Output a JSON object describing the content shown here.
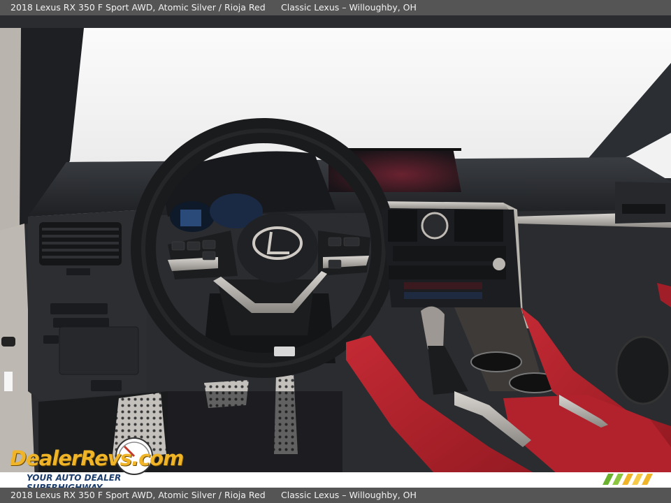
{
  "header": {
    "vehicle": "2018 Lexus RX 350 F Sport AWD,  Atomic Silver / Rioja Red",
    "dealer": "Classic Lexus – Willoughby, OH"
  },
  "footer": {
    "vehicle": "2018 Lexus RX 350 F Sport AWD,  Atomic Silver / Rioja Red",
    "dealer": "Classic Lexus – Willoughby, OH"
  },
  "watermark": {
    "logo_text": "DealerRevs.com",
    "tagline": "YOUR AUTO DEALER SUPERHIGHWAY"
  },
  "colors": {
    "bar_bg": "#555555",
    "upholstery_red": "#b8232c",
    "logo_yellow": "#f0b429",
    "logo_blue": "#1c3e6e"
  }
}
